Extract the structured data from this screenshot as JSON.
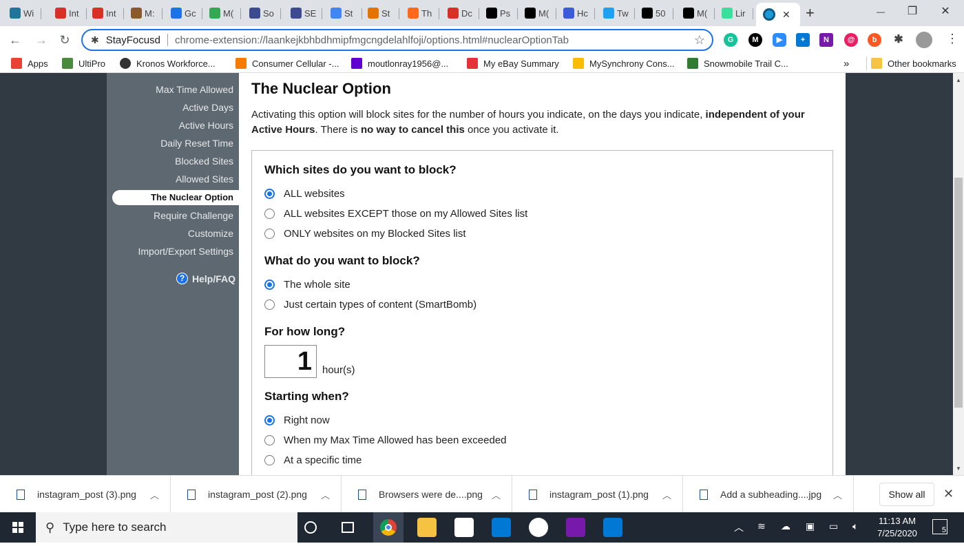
{
  "tabs": [
    {
      "label": "Wi",
      "icon": "wordpress-icon",
      "color": "#21759b"
    },
    {
      "label": "Int",
      "icon": "gmail-icon",
      "color": "#d93025"
    },
    {
      "label": "Int",
      "icon": "gmail-icon",
      "color": "#d93025"
    },
    {
      "label": "M:",
      "icon": "bookmark-tab-icon",
      "color": "#8a5a2b"
    },
    {
      "label": "Gc",
      "icon": "calendar-icon",
      "color": "#1a73e8"
    },
    {
      "label": "M(",
      "icon": "google-drive-icon",
      "color": "#34a853"
    },
    {
      "label": "So",
      "icon": "calendar-icon",
      "color": "#3c4a8f"
    },
    {
      "label": "SE",
      "icon": "calendar-icon",
      "color": "#3c4a8f"
    },
    {
      "label": "St",
      "icon": "docs-icon",
      "color": "#4285f4"
    },
    {
      "label": "St",
      "icon": "rainbow-icon",
      "color": "#e37400"
    },
    {
      "label": "Th",
      "icon": "substack-icon",
      "color": "#ff6719"
    },
    {
      "label": "Dc",
      "icon": "pdf-icon",
      "color": "#d93025"
    },
    {
      "label": "Ps",
      "icon": "medium-icon",
      "color": "#000000"
    },
    {
      "label": "M(",
      "icon": "medium-icon",
      "color": "#000000"
    },
    {
      "label": "Hc",
      "icon": "c-icon",
      "color": "#3b5bdb"
    },
    {
      "label": "Tw",
      "icon": "chart-icon",
      "color": "#1da1f2"
    },
    {
      "label": "50",
      "icon": "unsplash-icon",
      "color": "#000000"
    },
    {
      "label": "M(",
      "icon": "medium-icon",
      "color": "#000000"
    },
    {
      "label": "Lir",
      "icon": "linktree-icon",
      "color": "#39e09b"
    }
  ],
  "active_tab": {
    "icon": "stayfocusd-icon",
    "close": "✕"
  },
  "new_tab": "+",
  "window": {
    "minimize": "—",
    "restore": "❐",
    "close": "✕"
  },
  "nav": {
    "back": "←",
    "forward": "→",
    "reload": "↻"
  },
  "omnibox": {
    "site": "StayFocusd",
    "url": "chrome-extension://laankejkbhbdhmipfmgcngdelahlfoji/options.html#nuclearOptionTab",
    "star": "☆"
  },
  "extensions": [
    "grammarly-icon",
    "medium-icon",
    "zoom-icon",
    "plus-icon",
    "onenote-icon",
    "notification-icon",
    "b-icon",
    "puzzle-icon",
    "avatar"
  ],
  "bookmarks": [
    {
      "label": "Apps",
      "icon": "apps-icon"
    },
    {
      "label": "UltiPro",
      "icon": "ultipro-icon"
    },
    {
      "label": "Kronos Workforce...",
      "icon": "globe-icon"
    },
    {
      "label": "Consumer Cellular -...",
      "icon": "consumer-cellular-icon"
    },
    {
      "label": "moutlonray1956@...",
      "icon": "yahoo-mail-icon"
    },
    {
      "label": "My eBay Summary",
      "icon": "ebay-icon"
    },
    {
      "label": "MySynchrony Cons...",
      "icon": "synchrony-icon"
    },
    {
      "label": "Snowmobile Trail C...",
      "icon": "trail-icon"
    }
  ],
  "bookmarks_overflow": "»",
  "other_bookmarks": "Other bookmarks",
  "sidebar": {
    "items": [
      "Max Time Allowed",
      "Active Days",
      "Active Hours",
      "Daily Reset Time",
      "Blocked Sites",
      "Allowed Sites",
      "The Nuclear Option",
      "Require Challenge",
      "Customize",
      "Import/Export Settings"
    ],
    "active": "The Nuclear Option",
    "help": "Help/FAQ"
  },
  "main": {
    "title": "The Nuclear Option",
    "desc_1": "Activating this option will block sites for the number of hours you indicate, on the days you indicate, ",
    "desc_2": "independent of your Active Hours",
    "desc_3": ". There is ",
    "desc_4": "no way to cancel this",
    "desc_5": " once you activate it.",
    "q1": "Which sites do you want to block?",
    "q1_options": [
      "ALL websites",
      "ALL websites EXCEPT those on my Allowed Sites list",
      "ONLY websites on my Blocked Sites list"
    ],
    "q1_selected": 0,
    "q2": "What do you want to block?",
    "q2_options": [
      "The whole site",
      "Just certain types of content (SmartBomb)"
    ],
    "q2_selected": 0,
    "q3": "For how long?",
    "hours_value": "1",
    "hours_unit": "hour(s)",
    "q4": "Starting when?",
    "q4_options": [
      "Right now",
      "When my Max Time Allowed has been exceeded",
      "At a specific time"
    ],
    "q4_selected": 0
  },
  "downloads": {
    "items": [
      "instagram_post (3).png",
      "instagram_post (2).png",
      "Browsers were de....png",
      "instagram_post (1).png",
      "Add a subheading....jpg"
    ],
    "show_all": "Show all",
    "close": "✕"
  },
  "taskbar": {
    "search_placeholder": "Type here to search",
    "time": "11:13 AM",
    "date": "7/25/2020",
    "notifications": "5"
  }
}
